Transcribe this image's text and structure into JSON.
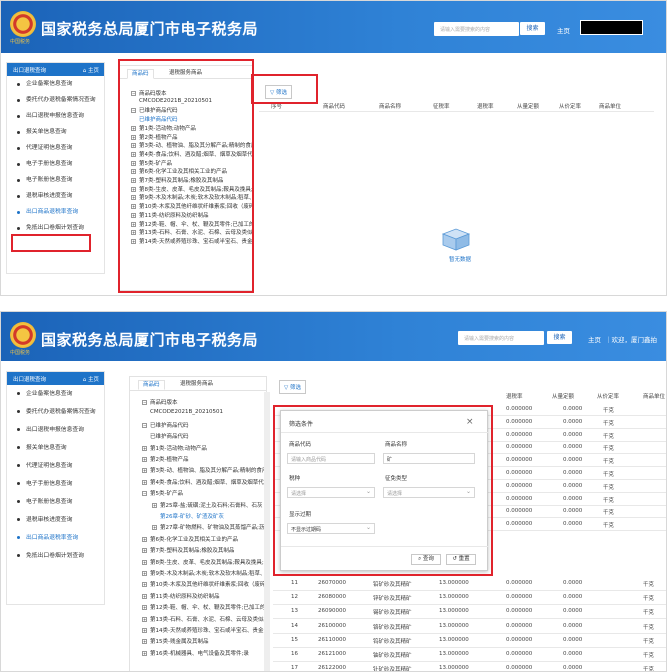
{
  "header": {
    "title": "国家税务总局厦门市电子税务局",
    "emblem_caption": "中国税务",
    "search_placeholder": "请输入需要搜索的内容",
    "search_button": "搜索",
    "home_link": "主页",
    "welcome_text": "｜欢迎，厦门鑫拍"
  },
  "sidebar": {
    "heading": "出口退税查询",
    "home": "主页",
    "items": [
      "企业备案信息查询",
      "委托代办退税备案情况查询",
      "出口退税申报信息查询",
      "报关单信息查询",
      "代理证明信息查询",
      "电子手册信息查询",
      "电子账册信息查询",
      "退税审核进度查询",
      "出口商品退税率查询",
      "免抵出口卷烟计划查询"
    ],
    "active_index": 8
  },
  "tree": {
    "tabs": [
      "商品码",
      "退税服务商品"
    ],
    "nodes1": [
      {
        "t": "商品码版本",
        "box": "−"
      },
      {
        "t": "CMCODE2021B_20210501",
        "box": ""
      },
      {
        "t": "已维护商品代码",
        "box": "−"
      },
      {
        "t": "已维护商品代码",
        "box": "",
        "blue": true
      },
      {
        "t": "第1类-活动物;动物产品",
        "box": "+"
      },
      {
        "t": "第2类-植物产品",
        "box": "+"
      },
      {
        "t": "第3类-动、植物油、脂及其分解产品;精制的食用",
        "box": "+"
      },
      {
        "t": "第4类-食品;饮料、酒及醋;烟草、烟草及烟草代用",
        "box": "+"
      },
      {
        "t": "第5类-矿产品",
        "box": "+"
      },
      {
        "t": "第6类-化学工业及其相关工业的产品",
        "box": "+"
      },
      {
        "t": "第7类-塑料及其制品;橡胶及其制品",
        "box": "+"
      },
      {
        "t": "第8类-生皮、皮革、毛皮及其制品;鞍具及挽具;旅",
        "box": "+"
      },
      {
        "t": "第9类-木及木制品;木炭;软木及软木制品;稻草、",
        "box": "+"
      },
      {
        "t": "第10类-木浆及其他纤维状纤维素浆;回收（废碎",
        "box": "+"
      },
      {
        "t": "第11类-纺织原料及纺织制品",
        "box": "+"
      },
      {
        "t": "第12类-鞋、帽、伞、杖、鞭及其零件;已加工的",
        "box": "+"
      },
      {
        "t": "第13类-石料、石膏、水泥、石棉、云母及类似材",
        "box": "+"
      },
      {
        "t": "第14类-天然或养殖珍珠、宝石或半宝石、贵金",
        "box": "+"
      }
    ],
    "nodes2": [
      {
        "t": "商品码版本",
        "box": "−"
      },
      {
        "t": "CMCODE2021B_20210501",
        "box": ""
      },
      {
        "t": "已维护商品代码",
        "box": "−"
      },
      {
        "t": "已维护商品代码",
        "box": ""
      },
      {
        "t": "第1类-活动物;动物产品",
        "box": "+"
      },
      {
        "t": "第2类-植物产品",
        "box": "+"
      },
      {
        "t": "第3类-动、植物油、脂及其分解产品;精制的食用",
        "box": "+"
      },
      {
        "t": "第4类-食品;饮料、酒及醋;烟草、烟草及烟草代用",
        "box": "+"
      },
      {
        "t": "第5类-矿产品",
        "box": "−"
      },
      {
        "t": "第25章-盐;硫磺;泥土及石料;石膏料、石灰",
        "box": "+"
      },
      {
        "t": "第26章-矿砂、矿渣及矿灰",
        "box": "",
        "blue": true
      },
      {
        "t": "第27章-矿物燃料、矿物油及其蒸馏产品;沥",
        "box": "+"
      },
      {
        "t": "第6类-化学工业及其相关工业的产品",
        "box": "+"
      },
      {
        "t": "第7类-塑料及其制品;橡胶及其制品",
        "box": "+"
      },
      {
        "t": "第8类-生皮、皮革、毛皮及其制品;鞍具及挽具;旅",
        "box": "+"
      },
      {
        "t": "第9类-木及木制品;木炭;软木及软木制品;稻草、",
        "box": "+"
      },
      {
        "t": "第10类-木浆及其他纤维状纤维素浆;回收（废碎",
        "box": "+"
      },
      {
        "t": "第11类-纺织原料及纺织制品",
        "box": "+"
      },
      {
        "t": "第12类-鞋、帽、伞、杖、鞭及其零件;已加工的",
        "box": "+"
      },
      {
        "t": "第13类-石料、石膏、水泥、石棉、云母及类似材",
        "box": "+"
      },
      {
        "t": "第14类-天然或养殖珍珠、宝石或半宝石、贵金",
        "box": "+"
      },
      {
        "t": "第15类-贱金属及其制品",
        "box": "+"
      },
      {
        "t": "第16类-机械器具、电气设备及其零件;录",
        "box": "+"
      }
    ]
  },
  "table": {
    "filter_label": "筛选",
    "columns": [
      "序号",
      "商品代码",
      "商品名称",
      "征税率",
      "退税率",
      "从量定额",
      "从价定率",
      "商品单位"
    ],
    "empty_text": "暂无数据",
    "rows": [
      [
        "11",
        "26070000",
        "铅矿砂及其精矿",
        "13.000000",
        "",
        "0.000000",
        "0.0000",
        "千克"
      ],
      [
        "12",
        "26080000",
        "锌矿砂及其精矿",
        "13.000000",
        "",
        "0.000000",
        "0.0000",
        "千克"
      ],
      [
        "13",
        "26090000",
        "锡矿砂及其精矿",
        "13.000000",
        "",
        "0.000000",
        "0.0000",
        "千克"
      ],
      [
        "14",
        "26100000",
        "铬矿砂及其精矿",
        "13.000000",
        "",
        "0.000000",
        "0.0000",
        "千克"
      ],
      [
        "15",
        "26110000",
        "钨矿砂及其精矿",
        "13.000000",
        "",
        "0.000000",
        "0.0000",
        "千克"
      ],
      [
        "16",
        "26121000",
        "铀矿砂及其精矿",
        "13.000000",
        "",
        "0.000000",
        "0.0000",
        "千克"
      ],
      [
        "17",
        "26122000",
        "钍矿砂及其精矿",
        "13.000000",
        "",
        "0.000000",
        "0.0000",
        "千克"
      ]
    ],
    "right_rows": [
      [
        "0.000000",
        "0.0000",
        "千克"
      ],
      [
        "0.000000",
        "0.0000",
        "千克"
      ],
      [
        "0.000000",
        "0.0000",
        "千克"
      ],
      [
        "0.000000",
        "0.0000",
        "千克"
      ],
      [
        "0.000000",
        "0.0000",
        "千克"
      ],
      [
        "0.000000",
        "0.0000",
        "千克"
      ],
      [
        "0.000000",
        "0.0000",
        "千克"
      ],
      [
        "0.000000",
        "0.0000",
        "千克"
      ],
      [
        "0.000000",
        "0.0000",
        "千克"
      ],
      [
        "0.000000",
        "0.0000",
        "千克"
      ]
    ]
  },
  "dialog": {
    "title": "筛选条件",
    "code_label": "商品代码",
    "code_placeholder": "请输入商品代码",
    "name_label": "商品名称",
    "name_value": "矿",
    "tax_label": "税种",
    "tax_placeholder": "请选择",
    "levy_label": "征免类型",
    "levy_placeholder": "请选择",
    "expired_label": "显示过期",
    "expired_value": "不显示过期码",
    "query_button": "查询",
    "reset_button": "重置"
  }
}
